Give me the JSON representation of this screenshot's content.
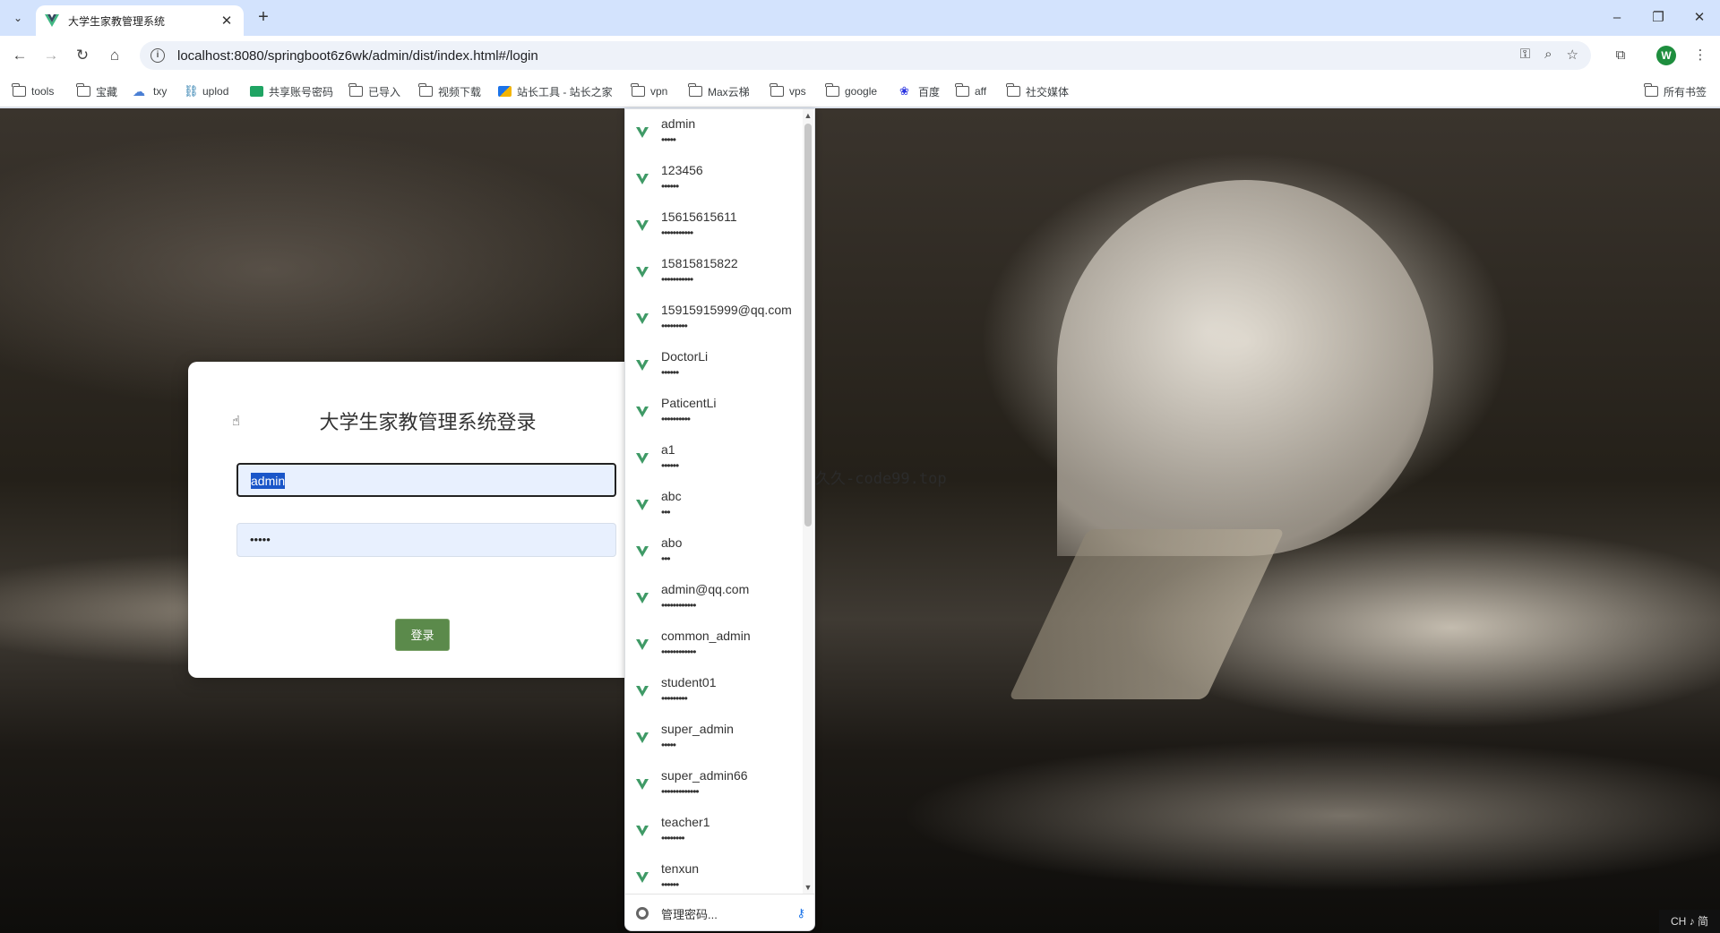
{
  "browser": {
    "tab_title": "大学生家教管理系统",
    "tab_close": "✕",
    "new_tab": "+",
    "url": "localhost:8080/springboot6z6wk/admin/dist/index.html#/login",
    "profile_initial": "W",
    "window_controls": [
      "–",
      "❐",
      "✕"
    ]
  },
  "bookmarks": [
    {
      "label": "tools",
      "icon": "folder-icon"
    },
    {
      "label": "宝藏",
      "icon": "folder-icon"
    },
    {
      "label": "txy",
      "icon": "cloud-icon"
    },
    {
      "label": "uplod",
      "icon": "uplod-icon"
    },
    {
      "label": "共享账号密码",
      "icon": "sheet-icon"
    },
    {
      "label": "已导入",
      "icon": "folder-icon"
    },
    {
      "label": "视频下载",
      "icon": "folder-icon"
    },
    {
      "label": "站长工具 - 站长之家",
      "icon": "tool-icon"
    },
    {
      "label": "vpn",
      "icon": "folder-icon"
    },
    {
      "label": "Max云梯",
      "icon": "folder-icon"
    },
    {
      "label": "vps",
      "icon": "folder-icon"
    },
    {
      "label": "google",
      "icon": "folder-icon"
    },
    {
      "label": "百度",
      "icon": "baidu-icon"
    },
    {
      "label": "aff",
      "icon": "folder-icon"
    },
    {
      "label": "社交媒体",
      "icon": "folder-icon"
    }
  ],
  "bookmarks_right": "所有书签",
  "login": {
    "title": "大学生家教管理系统登录",
    "username_value": "admin",
    "password_mask": "•••••",
    "submit_label": "登录"
  },
  "watermark": {
    "cn": "源码久久",
    "en": "-code99.top"
  },
  "autofill": {
    "items": [
      {
        "username": "admin",
        "password_mask": "•••••"
      },
      {
        "username": "123456",
        "password_mask": "••••••"
      },
      {
        "username": "15615615611",
        "password_mask": "•••••••••••"
      },
      {
        "username": "15815815822",
        "password_mask": "•••••••••••"
      },
      {
        "username": "15915915999@qq.com",
        "password_mask": "•••••••••"
      },
      {
        "username": "DoctorLi",
        "password_mask": "••••••"
      },
      {
        "username": "PaticentLi",
        "password_mask": "••••••••••"
      },
      {
        "username": "a1",
        "password_mask": "••••••"
      },
      {
        "username": "abc",
        "password_mask": "•••"
      },
      {
        "username": "abo",
        "password_mask": "•••"
      },
      {
        "username": "admin@qq.com",
        "password_mask": "••••••••••••"
      },
      {
        "username": "common_admin",
        "password_mask": "••••••••••••"
      },
      {
        "username": "student01",
        "password_mask": "•••••••••"
      },
      {
        "username": "super_admin",
        "password_mask": "•••••"
      },
      {
        "username": "super_admin66",
        "password_mask": "•••••••••••••"
      },
      {
        "username": "teacher1",
        "password_mask": "••••••••"
      },
      {
        "username": "tenxun",
        "password_mask": "••••••"
      }
    ],
    "manage_label": "管理密码..."
  },
  "ime": "CH ♪ 简",
  "colors": {
    "tab_strip": "#d3e3fd",
    "login_button": "#5b8a4b",
    "vue_green": "#3f9a66"
  }
}
